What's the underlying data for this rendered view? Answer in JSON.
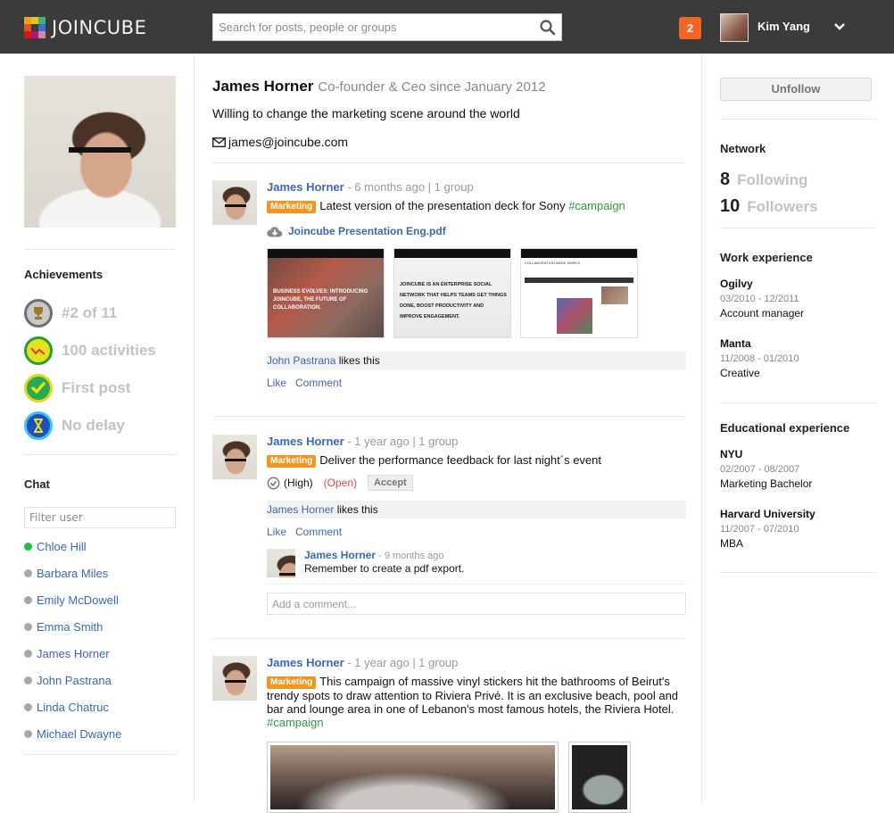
{
  "header": {
    "logo_text": "JOINCUBE",
    "logo_colors": [
      "#e8a41c",
      "#e6c21a",
      "#3cb47a",
      "#e2561e",
      "#3b3b3b",
      "#3b6fd8",
      "#d6151c",
      "#b4137a",
      "#c98aa8"
    ],
    "search_placeholder": "Search for posts, people or groups",
    "search_value": "",
    "notification_count": "2",
    "user_name": "Kim Yang"
  },
  "left": {
    "achievements_title": "Achievements",
    "achievements": [
      {
        "icon": "trophy-icon",
        "label": "#2 of 11"
      },
      {
        "icon": "activity-graph-icon",
        "label": "100 activities"
      },
      {
        "icon": "checkmark-icon",
        "label": "First post"
      },
      {
        "icon": "hourglass-icon",
        "label": "No delay"
      }
    ],
    "chat_title": "Chat",
    "filter_placeholder": "Filter user",
    "chat_users": [
      {
        "name": "Chloe Hill",
        "online": true
      },
      {
        "name": "Barbara Miles",
        "online": false
      },
      {
        "name": "Emily McDowell",
        "online": false
      },
      {
        "name": "Emma Smith",
        "online": false
      },
      {
        "name": "James Horner",
        "online": false
      },
      {
        "name": "John Pastrana",
        "online": false
      },
      {
        "name": "Linda Chatruc",
        "online": false
      },
      {
        "name": "Michael Dwayne",
        "online": false
      }
    ]
  },
  "profile": {
    "name": "James Horner",
    "role": "Co-founder & Ceo since January 2012",
    "bio": "Willing to change the marketing scene around the world",
    "email": "james@joincube.com"
  },
  "posts": [
    {
      "author": "James Horner",
      "meta": " - 6 months ago | 1 group",
      "tag": "Marketing",
      "text": "Latest version of the presentation deck for Sony ",
      "hashtag": "#campaign",
      "attachment": "Joincube Presentation Eng.pdf",
      "thumbs": [
        {
          "caption": "BUSINESS EVOLVES: INTRODUCING JOINCUBE, THE FUTURE OF COLLABORATION."
        },
        {
          "caption": "JOINCUBE IS AN ENTERPRISE SOCIAL NETWORK THAT HELPS TEAMS GET THINGS DONE, BOOST PRODUCTIVITY AND IMPROVE ENGAGEMENT."
        },
        {
          "caption": "COLLABORATION MADE SIMPLE"
        }
      ],
      "liker": "John Pastrana",
      "likes_suffix": " likes this",
      "like_label": "Like",
      "comment_label": "Comment"
    },
    {
      "author": "James Horner",
      "meta": " - 1 year ago | 1 group",
      "tag": "Marketing",
      "text": "Deliver the performance feedback for last night´s event",
      "priority": "(High)",
      "status": "(Open)",
      "accept_label": "Accept",
      "liker": "James Horner",
      "likes_suffix": " likes this",
      "like_label": "Like",
      "comment_label": "Comment",
      "comment": {
        "author": "James Horner",
        "time": " - 9 months ago",
        "text": "Remember to create a pdf export."
      },
      "comment_placeholder": "Add a comment..."
    },
    {
      "author": "James Horner",
      "meta": " - 1 year ago | 1 group",
      "tag": "Marketing",
      "text": "This campaign of massive vinyl stickers hit the bathrooms of Beirut's trendy spots to draw attention to Riviera Privé. It is an exclusive beach, pool and bar and lounge area in one of Lebanon's most famous hotels, the Riviera Hotel. ",
      "hashtag": "#campaign"
    }
  ],
  "right": {
    "unfollow_label": "Unfollow",
    "network_title": "Network",
    "following_count": "8",
    "following_label": "Following",
    "followers_count": "10",
    "followers_label": "Followers",
    "work_title": "Work experience",
    "work": [
      {
        "org": "Ogilvy",
        "dates": "03/2010 - 12/2011",
        "role": "Account manager"
      },
      {
        "org": "Manta",
        "dates": "11/2008 - 01/2010",
        "role": "Creative"
      }
    ],
    "edu_title": "Educational experience",
    "education": [
      {
        "org": "NYU",
        "dates": "02/2007 - 08/2007",
        "role": "Marketing Bachelor"
      },
      {
        "org": "Harvard University",
        "dates": "11/2007 - 07/2010",
        "role": "MBA"
      }
    ]
  },
  "colors": {
    "topbar": "#3b3b3b",
    "link": "#3b67b8",
    "tag": "#f7941d",
    "hashtag": "#2c9b3a",
    "notification": "#f26522",
    "online": "#1fbf3a",
    "open_status": "#e54545"
  }
}
